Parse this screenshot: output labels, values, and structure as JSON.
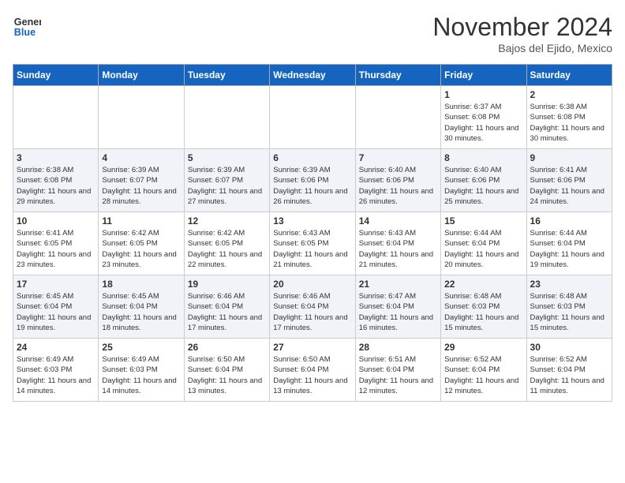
{
  "logo": {
    "line1": "General",
    "line2": "Blue"
  },
  "header": {
    "month": "November 2024",
    "location": "Bajos del Ejido, Mexico"
  },
  "weekdays": [
    "Sunday",
    "Monday",
    "Tuesday",
    "Wednesday",
    "Thursday",
    "Friday",
    "Saturday"
  ],
  "rows": [
    [
      {
        "day": "",
        "sunrise": "",
        "sunset": "",
        "daylight": ""
      },
      {
        "day": "",
        "sunrise": "",
        "sunset": "",
        "daylight": ""
      },
      {
        "day": "",
        "sunrise": "",
        "sunset": "",
        "daylight": ""
      },
      {
        "day": "",
        "sunrise": "",
        "sunset": "",
        "daylight": ""
      },
      {
        "day": "",
        "sunrise": "",
        "sunset": "",
        "daylight": ""
      },
      {
        "day": "1",
        "sunrise": "Sunrise: 6:37 AM",
        "sunset": "Sunset: 6:08 PM",
        "daylight": "Daylight: 11 hours and 30 minutes."
      },
      {
        "day": "2",
        "sunrise": "Sunrise: 6:38 AM",
        "sunset": "Sunset: 6:08 PM",
        "daylight": "Daylight: 11 hours and 30 minutes."
      }
    ],
    [
      {
        "day": "3",
        "sunrise": "Sunrise: 6:38 AM",
        "sunset": "Sunset: 6:08 PM",
        "daylight": "Daylight: 11 hours and 29 minutes."
      },
      {
        "day": "4",
        "sunrise": "Sunrise: 6:39 AM",
        "sunset": "Sunset: 6:07 PM",
        "daylight": "Daylight: 11 hours and 28 minutes."
      },
      {
        "day": "5",
        "sunrise": "Sunrise: 6:39 AM",
        "sunset": "Sunset: 6:07 PM",
        "daylight": "Daylight: 11 hours and 27 minutes."
      },
      {
        "day": "6",
        "sunrise": "Sunrise: 6:39 AM",
        "sunset": "Sunset: 6:06 PM",
        "daylight": "Daylight: 11 hours and 26 minutes."
      },
      {
        "day": "7",
        "sunrise": "Sunrise: 6:40 AM",
        "sunset": "Sunset: 6:06 PM",
        "daylight": "Daylight: 11 hours and 26 minutes."
      },
      {
        "day": "8",
        "sunrise": "Sunrise: 6:40 AM",
        "sunset": "Sunset: 6:06 PM",
        "daylight": "Daylight: 11 hours and 25 minutes."
      },
      {
        "day": "9",
        "sunrise": "Sunrise: 6:41 AM",
        "sunset": "Sunset: 6:06 PM",
        "daylight": "Daylight: 11 hours and 24 minutes."
      }
    ],
    [
      {
        "day": "10",
        "sunrise": "Sunrise: 6:41 AM",
        "sunset": "Sunset: 6:05 PM",
        "daylight": "Daylight: 11 hours and 23 minutes."
      },
      {
        "day": "11",
        "sunrise": "Sunrise: 6:42 AM",
        "sunset": "Sunset: 6:05 PM",
        "daylight": "Daylight: 11 hours and 23 minutes."
      },
      {
        "day": "12",
        "sunrise": "Sunrise: 6:42 AM",
        "sunset": "Sunset: 6:05 PM",
        "daylight": "Daylight: 11 hours and 22 minutes."
      },
      {
        "day": "13",
        "sunrise": "Sunrise: 6:43 AM",
        "sunset": "Sunset: 6:05 PM",
        "daylight": "Daylight: 11 hours and 21 minutes."
      },
      {
        "day": "14",
        "sunrise": "Sunrise: 6:43 AM",
        "sunset": "Sunset: 6:04 PM",
        "daylight": "Daylight: 11 hours and 21 minutes."
      },
      {
        "day": "15",
        "sunrise": "Sunrise: 6:44 AM",
        "sunset": "Sunset: 6:04 PM",
        "daylight": "Daylight: 11 hours and 20 minutes."
      },
      {
        "day": "16",
        "sunrise": "Sunrise: 6:44 AM",
        "sunset": "Sunset: 6:04 PM",
        "daylight": "Daylight: 11 hours and 19 minutes."
      }
    ],
    [
      {
        "day": "17",
        "sunrise": "Sunrise: 6:45 AM",
        "sunset": "Sunset: 6:04 PM",
        "daylight": "Daylight: 11 hours and 19 minutes."
      },
      {
        "day": "18",
        "sunrise": "Sunrise: 6:45 AM",
        "sunset": "Sunset: 6:04 PM",
        "daylight": "Daylight: 11 hours and 18 minutes."
      },
      {
        "day": "19",
        "sunrise": "Sunrise: 6:46 AM",
        "sunset": "Sunset: 6:04 PM",
        "daylight": "Daylight: 11 hours and 17 minutes."
      },
      {
        "day": "20",
        "sunrise": "Sunrise: 6:46 AM",
        "sunset": "Sunset: 6:04 PM",
        "daylight": "Daylight: 11 hours and 17 minutes."
      },
      {
        "day": "21",
        "sunrise": "Sunrise: 6:47 AM",
        "sunset": "Sunset: 6:04 PM",
        "daylight": "Daylight: 11 hours and 16 minutes."
      },
      {
        "day": "22",
        "sunrise": "Sunrise: 6:48 AM",
        "sunset": "Sunset: 6:03 PM",
        "daylight": "Daylight: 11 hours and 15 minutes."
      },
      {
        "day": "23",
        "sunrise": "Sunrise: 6:48 AM",
        "sunset": "Sunset: 6:03 PM",
        "daylight": "Daylight: 11 hours and 15 minutes."
      }
    ],
    [
      {
        "day": "24",
        "sunrise": "Sunrise: 6:49 AM",
        "sunset": "Sunset: 6:03 PM",
        "daylight": "Daylight: 11 hours and 14 minutes."
      },
      {
        "day": "25",
        "sunrise": "Sunrise: 6:49 AM",
        "sunset": "Sunset: 6:03 PM",
        "daylight": "Daylight: 11 hours and 14 minutes."
      },
      {
        "day": "26",
        "sunrise": "Sunrise: 6:50 AM",
        "sunset": "Sunset: 6:04 PM",
        "daylight": "Daylight: 11 hours and 13 minutes."
      },
      {
        "day": "27",
        "sunrise": "Sunrise: 6:50 AM",
        "sunset": "Sunset: 6:04 PM",
        "daylight": "Daylight: 11 hours and 13 minutes."
      },
      {
        "day": "28",
        "sunrise": "Sunrise: 6:51 AM",
        "sunset": "Sunset: 6:04 PM",
        "daylight": "Daylight: 11 hours and 12 minutes."
      },
      {
        "day": "29",
        "sunrise": "Sunrise: 6:52 AM",
        "sunset": "Sunset: 6:04 PM",
        "daylight": "Daylight: 11 hours and 12 minutes."
      },
      {
        "day": "30",
        "sunrise": "Sunrise: 6:52 AM",
        "sunset": "Sunset: 6:04 PM",
        "daylight": "Daylight: 11 hours and 11 minutes."
      }
    ]
  ]
}
